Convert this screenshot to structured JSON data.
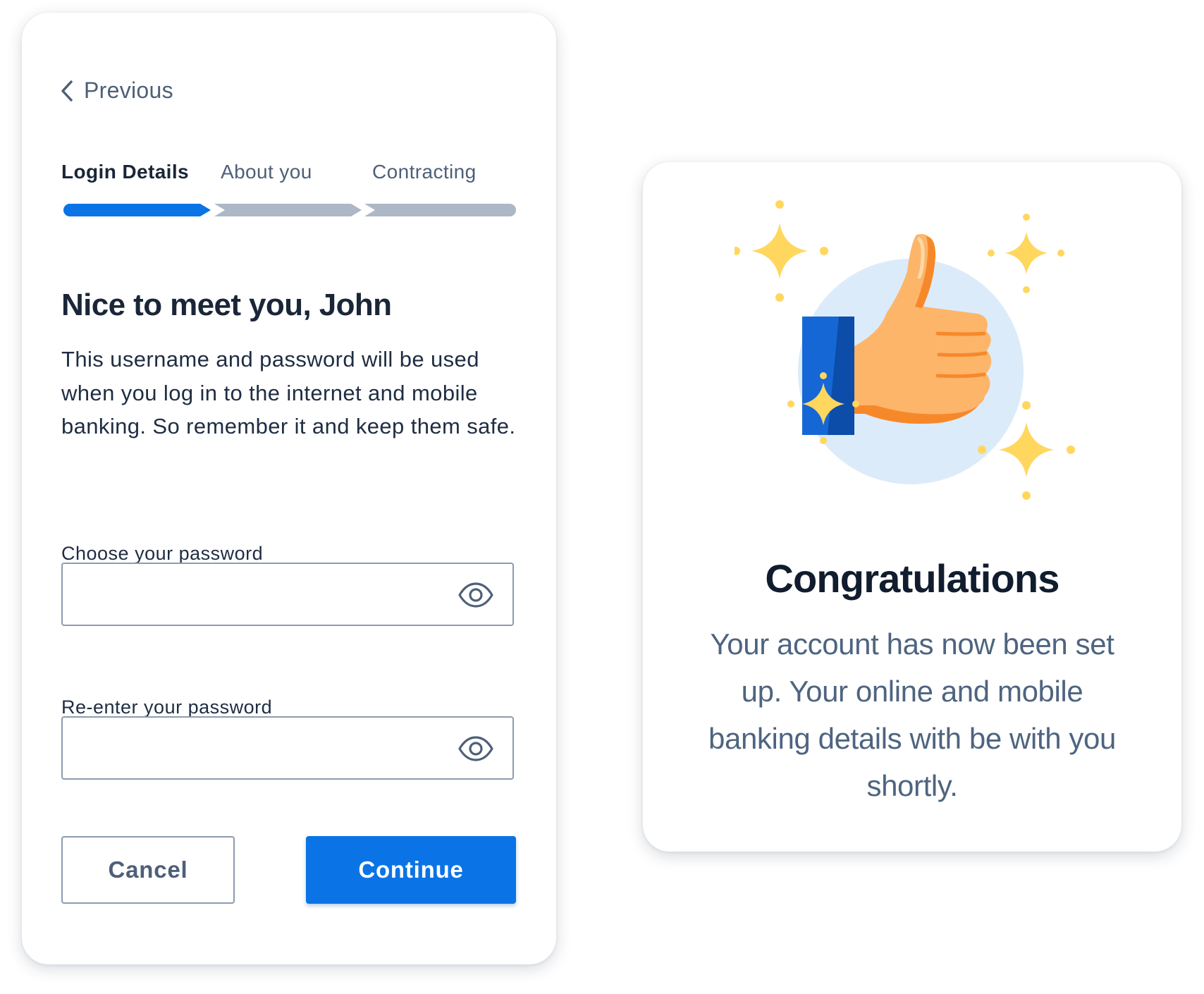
{
  "login_card": {
    "back_label": "Previous",
    "steps": [
      {
        "label": "Login Details",
        "state": "active"
      },
      {
        "label": "About you",
        "state": "inactive"
      },
      {
        "label": "Contracting",
        "state": "inactive"
      }
    ],
    "heading": "Nice to meet you, John",
    "intro": "This username and password will be used when you log in to the internet and mobile banking. So remember it and keep them safe.",
    "password_field": {
      "label": "Choose your password",
      "value": "",
      "placeholder": ""
    },
    "confirm_field": {
      "label": "Re-enter your password",
      "value": "",
      "placeholder": ""
    },
    "cancel_label": "Cancel",
    "continue_label": "Continue"
  },
  "congrats_card": {
    "title": "Congratulations",
    "message": "Your account has now been set up. Your online and mobile banking details with be with you shortly.",
    "illustration": "thumbs-up-with-sparkles"
  },
  "colors": {
    "primary": "#0A74E6",
    "step_inactive": "#ADB8C6",
    "text_dark": "#1A2638",
    "text_muted": "#4E5F78",
    "border": "#8D9BB0",
    "sparkle": "#FFD75E",
    "hand": "#FDB56A",
    "hand_shadow": "#F7882A",
    "sleeve": "#1667D6",
    "circle_bg": "#DDEBFA"
  }
}
